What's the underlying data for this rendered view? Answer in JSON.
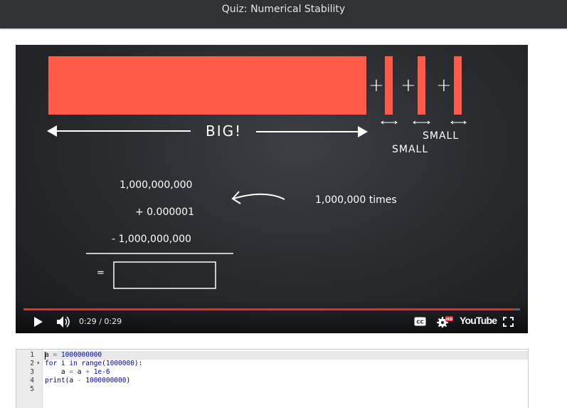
{
  "header": {
    "title": "Quiz: Numerical Stability"
  },
  "video": {
    "big_label": "BIG!",
    "small_label_1": "SMALL",
    "small_label_2": "SMALL",
    "plus": "+",
    "line1": "1,000,000,000",
    "line2": "+ 0.000001",
    "line3": "- 1,000,000,000",
    "times_label": "1,000,000 times",
    "equals": "=",
    "answer_box": "",
    "colors": {
      "bar": "#ff5a48",
      "progress": "#e52d27"
    }
  },
  "player": {
    "time": "0:29 / 0:29",
    "progress": 0.985,
    "icons": [
      "play-icon",
      "volume-icon",
      "captions-icon",
      "settings-icon",
      "hd-badge",
      "youtube-logo",
      "fullscreen-icon"
    ],
    "hd": "HD",
    "logo": "YouTube"
  },
  "editor": {
    "line_numbers": [
      "1",
      "2",
      "3",
      "4",
      "5"
    ],
    "lines": [
      [
        {
          "t": "a ",
          "c": ""
        },
        {
          "t": "=",
          "c": "op"
        },
        {
          "t": " ",
          "c": ""
        },
        {
          "t": "1000000000",
          "c": "num"
        }
      ],
      [
        {
          "t": "for",
          "c": "kw"
        },
        {
          "t": " i ",
          "c": ""
        },
        {
          "t": "in",
          "c": "kw"
        },
        {
          "t": " ",
          "c": ""
        },
        {
          "t": "range",
          "c": "fn"
        },
        {
          "t": "(",
          "c": ""
        },
        {
          "t": "1000000",
          "c": "num"
        },
        {
          "t": "):",
          "c": ""
        }
      ],
      [
        {
          "t": "    a ",
          "c": ""
        },
        {
          "t": "=",
          "c": "op"
        },
        {
          "t": " a ",
          "c": ""
        },
        {
          "t": "+",
          "c": "op"
        },
        {
          "t": " ",
          "c": ""
        },
        {
          "t": "1e-6",
          "c": "num"
        }
      ],
      [
        {
          "t": "print",
          "c": "fn"
        },
        {
          "t": "(a ",
          "c": ""
        },
        {
          "t": "-",
          "c": "op"
        },
        {
          "t": " ",
          "c": ""
        },
        {
          "t": "1000000000",
          "c": "num"
        },
        {
          "t": ")",
          "c": ""
        }
      ],
      []
    ]
  }
}
